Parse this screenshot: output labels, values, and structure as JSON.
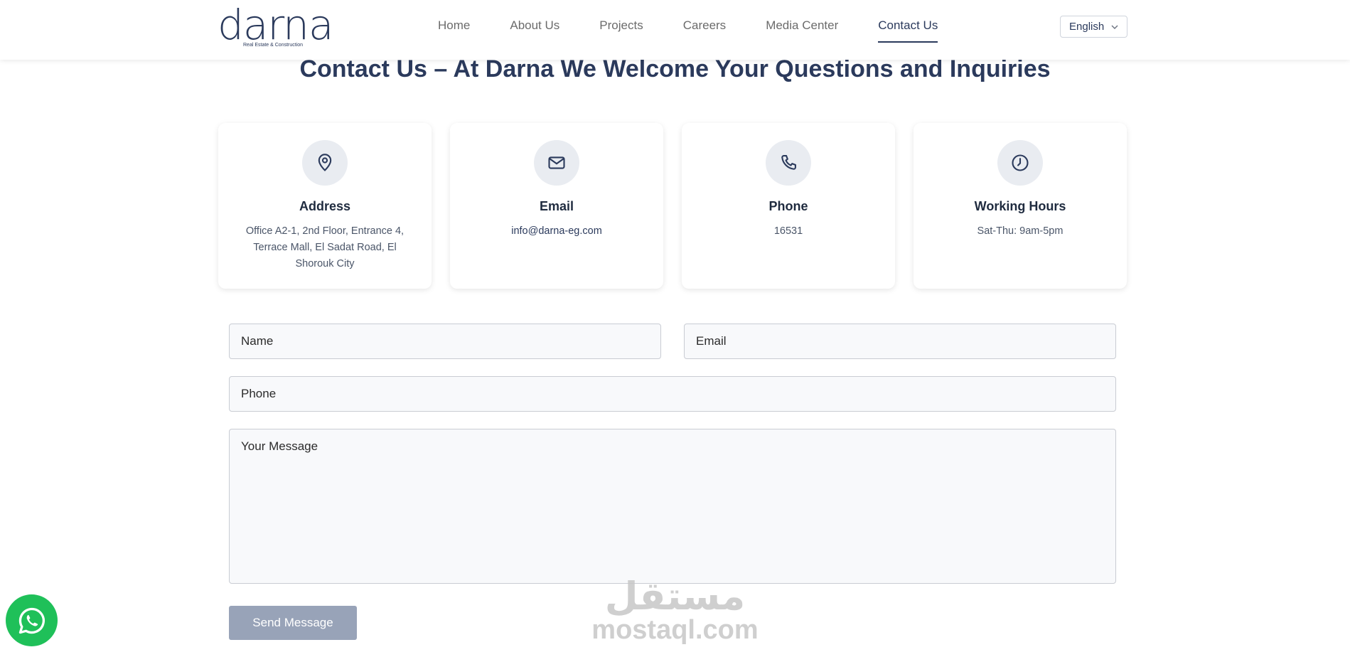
{
  "header": {
    "logo": {
      "word": "darna",
      "tagline": "Real Estate & Construction"
    },
    "nav": [
      "Home",
      "About Us",
      "Projects",
      "Careers",
      "Media Center",
      "Contact Us"
    ],
    "active_nav": "Contact Us",
    "language": "English"
  },
  "page": {
    "title": "Contact Us – At Darna We Welcome Your Questions and Inquiries"
  },
  "cards": [
    {
      "icon": "location-pin-icon",
      "title": "Address",
      "value": "Office A2-1, 2nd Floor, Entrance 4, Terrace Mall, El Sadat Road, El Shorouk City"
    },
    {
      "icon": "envelope-icon",
      "title": "Email",
      "value": "info@darna-eg.com"
    },
    {
      "icon": "phone-icon",
      "title": "Phone",
      "value": "16531"
    },
    {
      "icon": "clock-icon",
      "title": "Working Hours",
      "value": "Sat-Thu: 9am-5pm"
    }
  ],
  "form": {
    "name_placeholder": "Name",
    "email_placeholder": "Email",
    "phone_placeholder": "Phone",
    "message_placeholder": "Your Message",
    "submit_label": "Send Message"
  },
  "watermark": {
    "arabic": "مستقل",
    "latin": "mostaql.com"
  },
  "colors": {
    "brand": "#2b3a5c",
    "button": "#98a3b8",
    "whatsapp": "#1fc059"
  }
}
